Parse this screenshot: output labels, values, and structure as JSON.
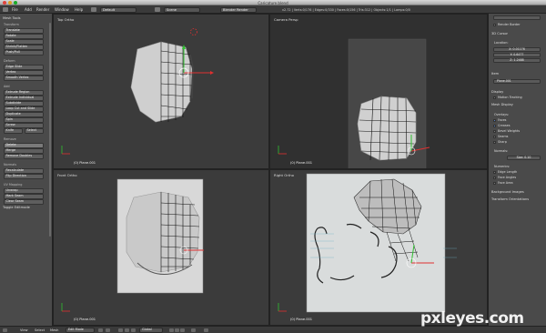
{
  "window": {
    "title": "Caricature.blend"
  },
  "info_header": {
    "menus": [
      "File",
      "Add",
      "Render",
      "Window",
      "Help"
    ],
    "layout": "Default",
    "scene": "Scene",
    "engine": "Blender Render",
    "stats": "v2.72 | Verts:0/176 | Edges:0/330 | Faces:0/156 | Tris:312 | Objects:1/1 | Lamps:0/0"
  },
  "tool_shelf": {
    "title": "Mesh Tools",
    "deform_label": "Transform",
    "transform": [
      "Translate",
      "Rotate",
      "Scale",
      "Shrink/Flatten",
      "Push/Pull"
    ],
    "deform_section": "Deform",
    "deform": [
      "Edge Slide",
      "Vertex",
      "Smooth Vertex"
    ],
    "add_section": "Add",
    "add": [
      "Extrude Region",
      "Extrude Individual",
      "Subdivide",
      "Loop Cut and Slide",
      "Duplicate",
      "Spin",
      "Screw"
    ],
    "knife": "Knife",
    "select": "Select",
    "remove_section": "Remove",
    "remove": [
      "Delete",
      "Merge",
      "Remove Doubles"
    ],
    "normals_section": "Normals",
    "normals": [
      "Recalculate",
      "Flip Direction"
    ],
    "uv_section": "UV Mapping",
    "uv": [
      "Unwrap",
      "Mark Seam",
      "Clear Seam"
    ],
    "toggle": "Toggle Editmode"
  },
  "viewports": {
    "top_left": {
      "label": "Top Ortho",
      "object": "(0) Plane.001"
    },
    "top_right": {
      "label": "Camera Persp",
      "object": "(0) Plane.001"
    },
    "bottom_left": {
      "label": "Front Ortho",
      "object": "(0) Plane.001"
    },
    "bottom_right": {
      "label": "Right Ortho",
      "object": "(0) Plane.001"
    }
  },
  "properties": {
    "view_hdr": "View",
    "lens": "Lens: 35.000",
    "lock": "Lock to Object",
    "cursor_hdr": "3D Cursor",
    "location": "Location:",
    "x": "X: 0.01176",
    "y": "Y: 0.6477",
    "z": "Z: 1.2488",
    "item_hdr": "Item",
    "item_name": "Plane.001",
    "display_hdr": "Display",
    "motion": "Motion Tracking",
    "mesh_display": "Mesh Display",
    "overlays_hdr": "Overlays:",
    "faces": "Faces",
    "creases": "Creases",
    "bevel": "Bevel Weights",
    "seams": "Seams",
    "sharp": "Sharp",
    "normals_hdr": "Normals:",
    "size": "Size: 0.10",
    "numerics": "Numerics:",
    "edge_length": "Edge Length",
    "face_angles": "Face Angles",
    "face_area": "Face Area",
    "bg_images": "Background Images",
    "transform_orient": "Transform Orientations",
    "render_border": "Render Border"
  },
  "footer": {
    "menus": [
      "View",
      "Select",
      "Mesh"
    ],
    "mode": "Edit Mode",
    "pivot": "Global"
  },
  "watermark": "pxleyes.com",
  "colors": {
    "mesh_gray": "#c9c9c9",
    "wire": "#111111",
    "axis_x": "#e03030",
    "axis_y": "#30c030",
    "ref_plane": "#d8d8d8"
  }
}
